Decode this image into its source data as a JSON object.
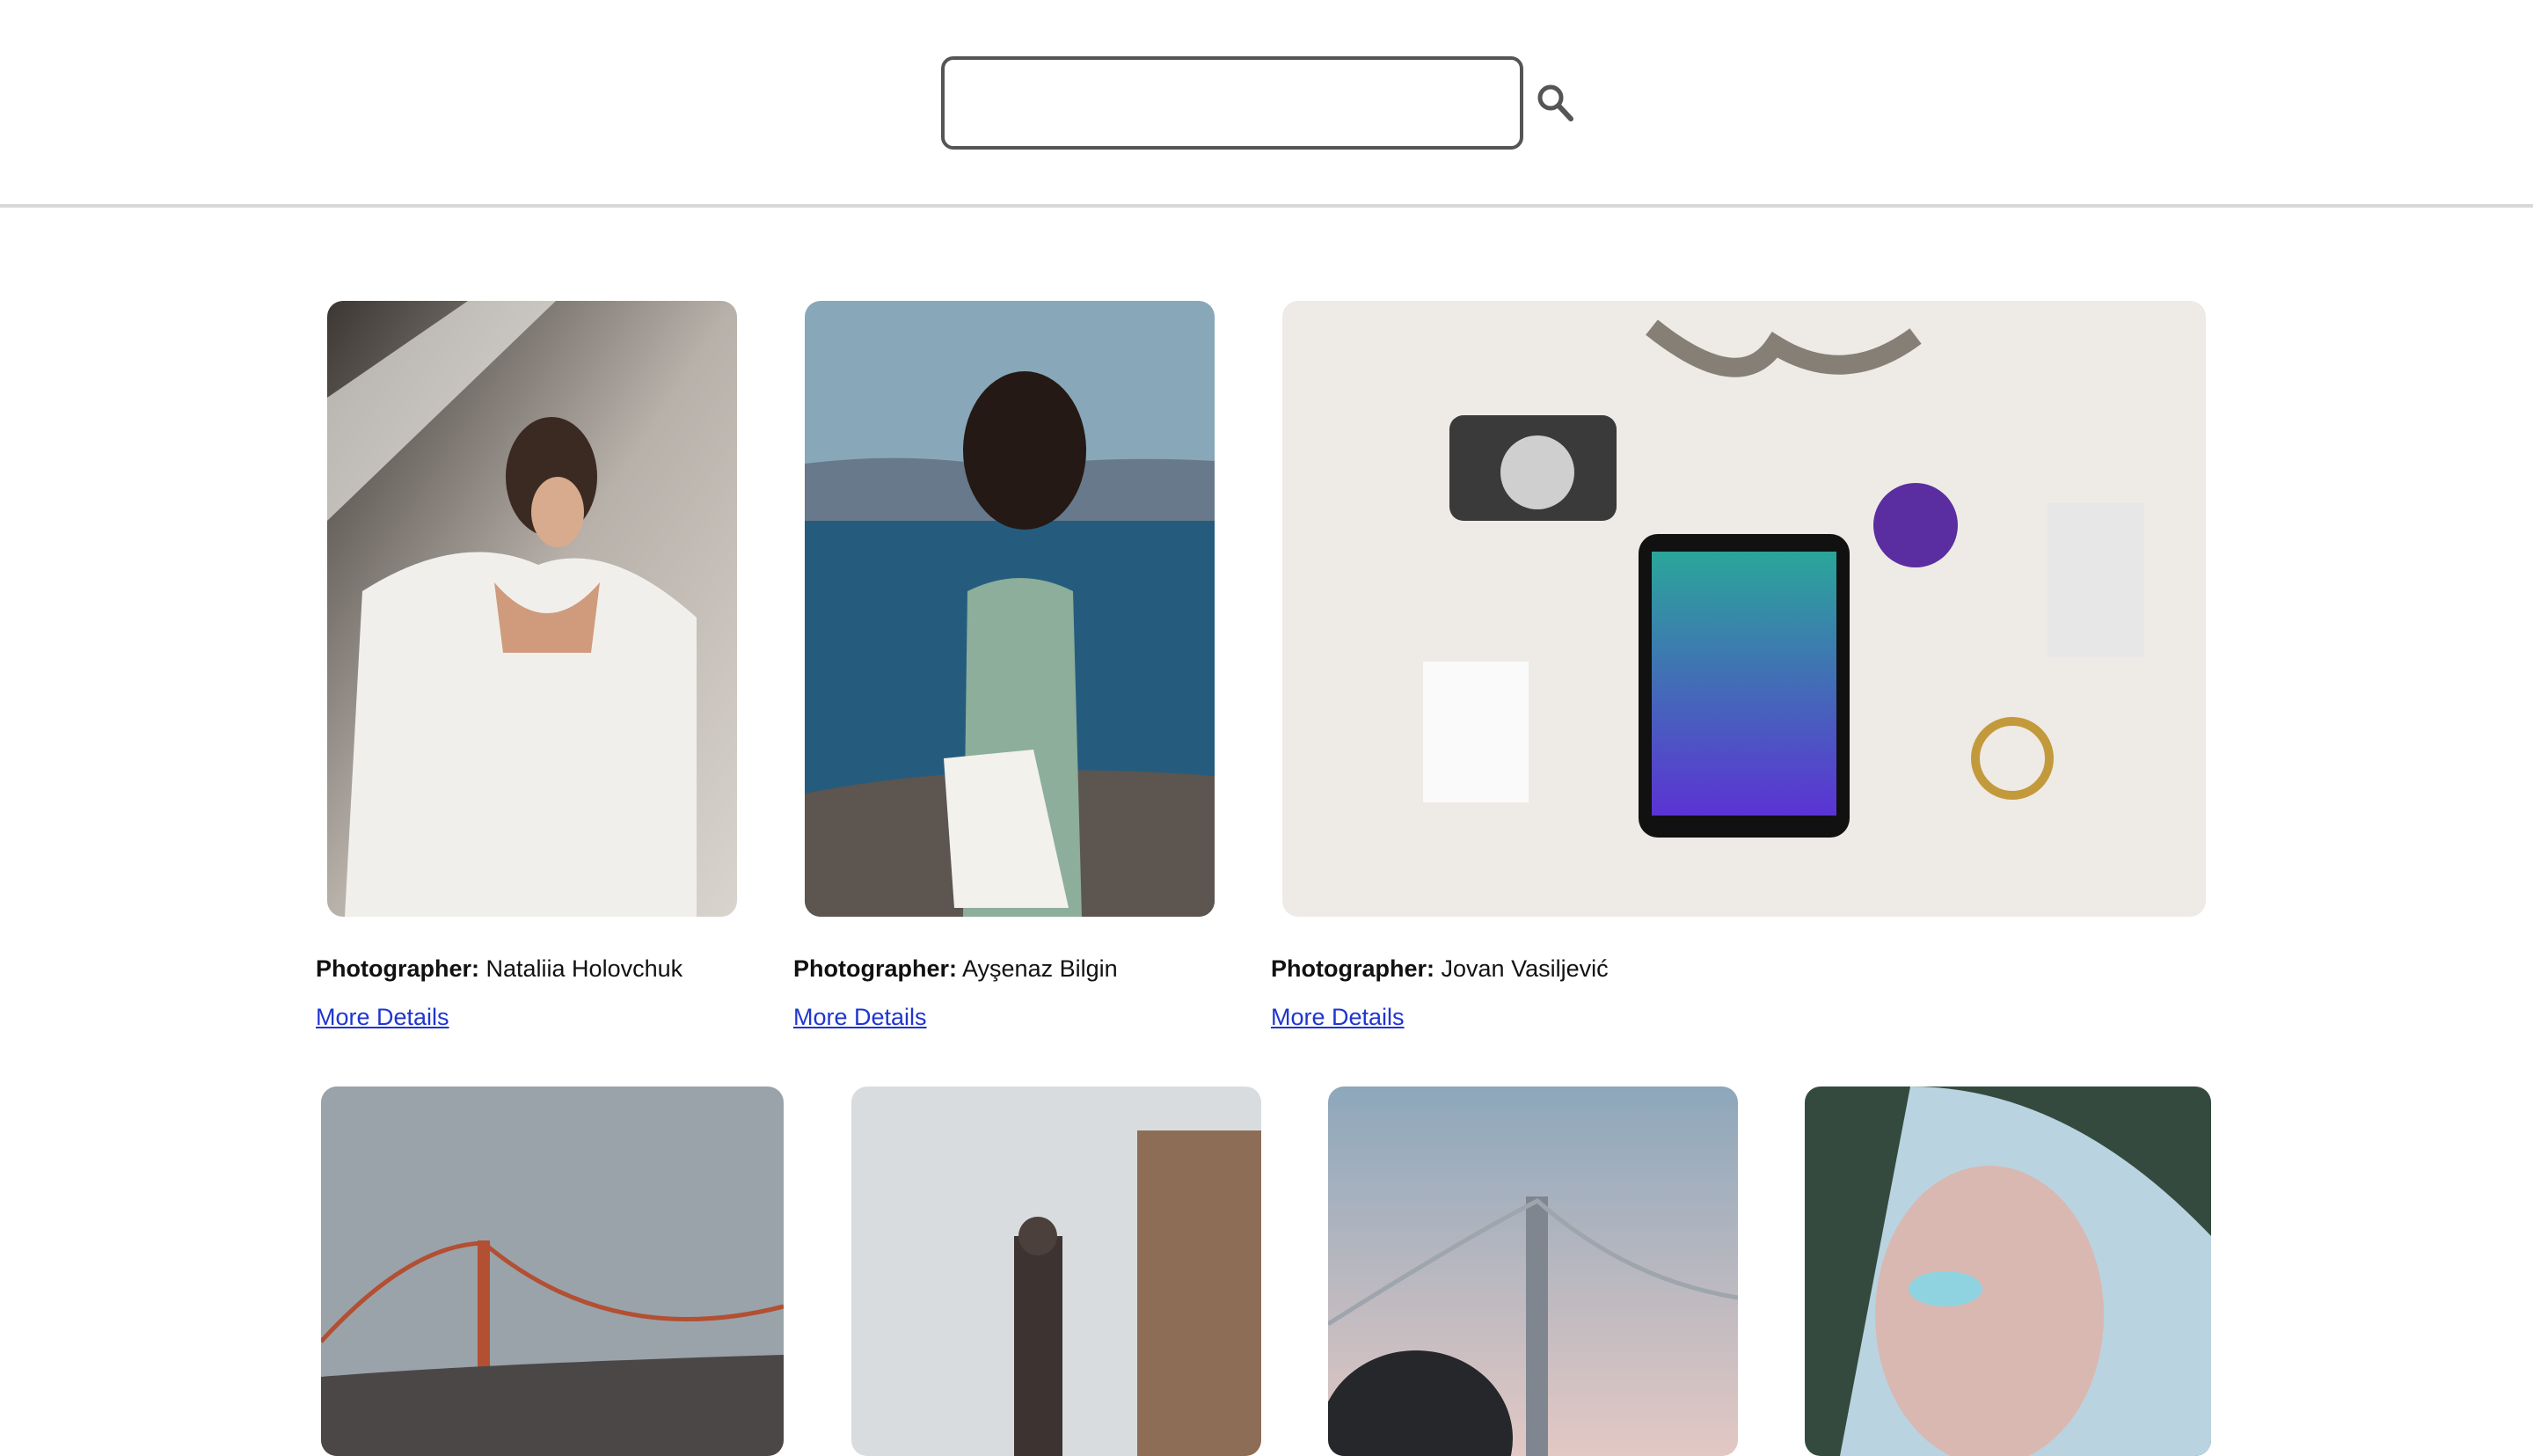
{
  "search": {
    "value": "",
    "placeholder": "",
    "icon": "search-icon"
  },
  "cards_row1": [
    {
      "label": "Photographer:",
      "name": "Nataliia Holovchuk",
      "link": "More Details"
    },
    {
      "label": "Photographer:",
      "name": "Ayşenaz Bilgin",
      "link": "More Details"
    },
    {
      "label": "Photographer:",
      "name": "Jovan Vasiljević",
      "link": "More Details"
    }
  ],
  "cards_row2_subjects": [
    "golden-gate-bridge",
    "clock-tower",
    "bay-bridge",
    "veiled-face"
  ],
  "colors": {
    "link": "#1f35d0",
    "border": "#d8d8d8"
  }
}
